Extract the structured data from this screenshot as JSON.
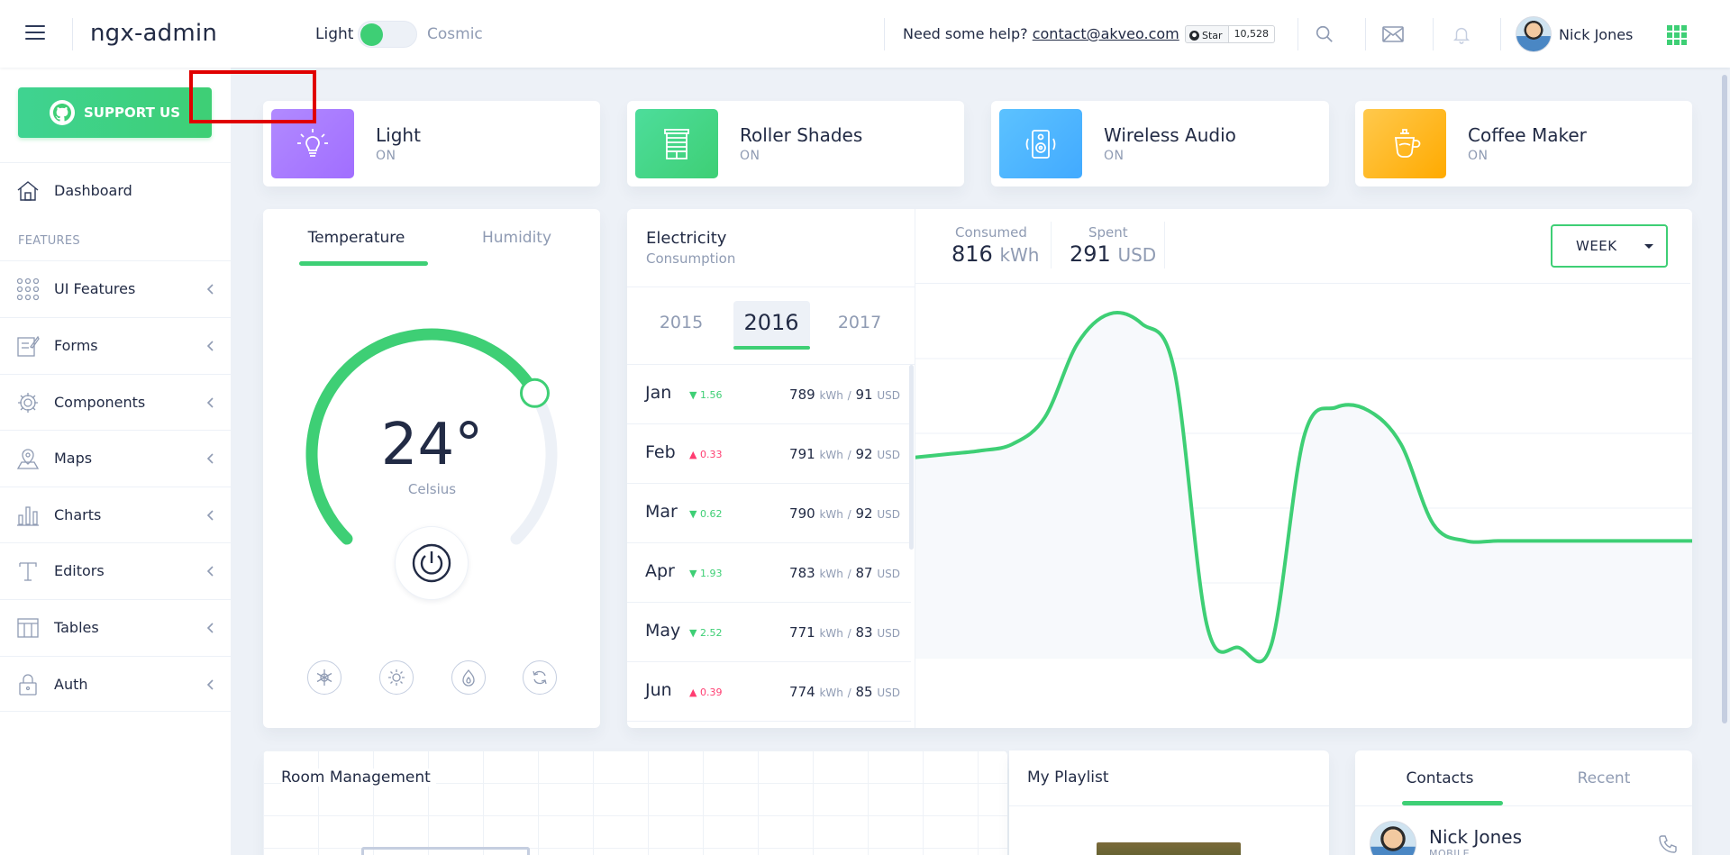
{
  "header": {
    "brand": "ngx-admin",
    "theme_light": "Light",
    "theme_cosmic": "Cosmic",
    "help_text": "Need some help?",
    "help_email": "contact@akveo.com",
    "gh_star": "Star",
    "gh_count": "10,528",
    "user_name": "Nick Jones"
  },
  "sidebar": {
    "support_label": "SUPPORT US",
    "features_label": "FEATURES",
    "items": [
      {
        "label": "Dashboard"
      },
      {
        "label": "UI Features"
      },
      {
        "label": "Forms"
      },
      {
        "label": "Components"
      },
      {
        "label": "Maps"
      },
      {
        "label": "Charts"
      },
      {
        "label": "Editors"
      },
      {
        "label": "Tables"
      },
      {
        "label": "Auth"
      }
    ]
  },
  "status_cards": [
    {
      "title": "Light",
      "status": "ON",
      "icon": "light-bulb-icon",
      "color": "#a16eff"
    },
    {
      "title": "Roller Shades",
      "status": "ON",
      "icon": "roller-shades-icon",
      "color": "#3ecf75"
    },
    {
      "title": "Wireless Audio",
      "status": "ON",
      "icon": "speaker-icon",
      "color": "#42aaff"
    },
    {
      "title": "Coffee Maker",
      "status": "ON",
      "icon": "coffee-maker-icon",
      "color": "#ffaa00"
    }
  ],
  "temperature": {
    "tabs": [
      "Temperature",
      "Humidity"
    ],
    "value": "24°",
    "unit": "Celsius",
    "level": 0.72,
    "modes": [
      "snowflake-icon",
      "sun-icon",
      "flame-icon",
      "refresh-icon"
    ]
  },
  "electricity": {
    "title": "Electricity",
    "subtitle": "Consumption",
    "years": [
      "2015",
      "2016",
      "2017"
    ],
    "active_year": "2016",
    "months": [
      {
        "month": "Jan",
        "delta": "1.56",
        "dir": "down",
        "kwh": "789",
        "usd": "91"
      },
      {
        "month": "Feb",
        "delta": "0.33",
        "dir": "up",
        "kwh": "791",
        "usd": "92"
      },
      {
        "month": "Mar",
        "delta": "0.62",
        "dir": "down",
        "kwh": "790",
        "usd": "92"
      },
      {
        "month": "Apr",
        "delta": "1.93",
        "dir": "down",
        "kwh": "783",
        "usd": "87"
      },
      {
        "month": "May",
        "delta": "2.52",
        "dir": "down",
        "kwh": "771",
        "usd": "83"
      },
      {
        "month": "Jun",
        "delta": "0.39",
        "dir": "up",
        "kwh": "774",
        "usd": "85"
      }
    ],
    "unit_kwh": "kWh",
    "unit_usd": "USD",
    "slash": "/",
    "consumed_label": "Consumed",
    "consumed_value": "816",
    "consumed_unit": "kWh",
    "spent_label": "Spent",
    "spent_value": "291",
    "spent_unit": "USD",
    "period": "WEEK"
  },
  "chart_data": {
    "type": "line",
    "x": [
      0,
      1,
      2,
      3,
      4,
      5,
      6,
      7,
      8,
      9,
      10,
      11,
      12,
      13,
      14,
      15,
      16,
      17,
      18,
      19,
      20,
      21,
      22,
      23,
      24
    ],
    "values": [
      300,
      305,
      310,
      320,
      360,
      470,
      515,
      500,
      430,
      50,
      15,
      20,
      330,
      375,
      370,
      320,
      200,
      175,
      175,
      175,
      175,
      175,
      175,
      175,
      175
    ],
    "ylim": [
      0,
      560
    ],
    "grid": true,
    "title": "",
    "xlabel": "",
    "ylabel": "",
    "color": "#3ecf75"
  },
  "bottom": {
    "room_title": "Room Management",
    "playlist_title": "My Playlist",
    "contacts_tabs": [
      "Contacts",
      "Recent"
    ],
    "contact_name": "Nick Jones",
    "contact_sub": "MOBILE"
  },
  "colors": {
    "accent": "#3ecf75",
    "text": "#222b45",
    "muted": "#8f9bb3",
    "background": "#edf1f7"
  }
}
